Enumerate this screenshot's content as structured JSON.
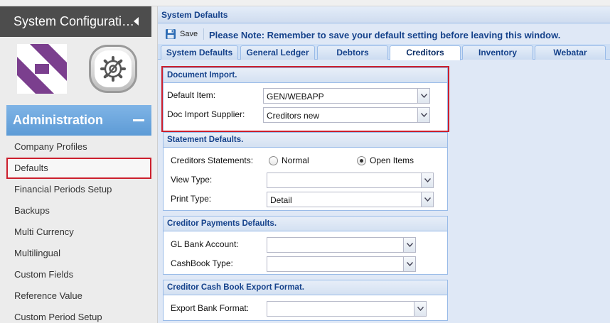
{
  "sidebar": {
    "title": "System Configurati…",
    "section_title": "Administration",
    "items": [
      {
        "label": "Company Profiles"
      },
      {
        "label": "Defaults",
        "selected": true
      },
      {
        "label": "Financial Periods Setup"
      },
      {
        "label": "Backups"
      },
      {
        "label": "Multi Currency"
      },
      {
        "label": "Multilingual"
      },
      {
        "label": "Custom Fields"
      },
      {
        "label": "Reference Value"
      },
      {
        "label": "Custom Period Setup"
      }
    ]
  },
  "panel": {
    "title": "System Defaults"
  },
  "toolbar": {
    "save_label": "Save",
    "note": "Please Note: Remember to save your default setting before leaving this window."
  },
  "tabs": [
    {
      "label": "System Defaults"
    },
    {
      "label": "General Ledger"
    },
    {
      "label": "Debtors"
    },
    {
      "label": "Creditors",
      "active": true
    },
    {
      "label": "Inventory"
    },
    {
      "label": "Webatar"
    }
  ],
  "document_import": {
    "header": "Document Import.",
    "default_item_label": "Default Item:",
    "default_item_value": "GEN/WEBAPP",
    "supplier_label": "Doc Import Supplier:",
    "supplier_value": "Creditors new"
  },
  "statement_defaults": {
    "header": "Statement Defaults.",
    "statements_label": "Creditors Statements:",
    "option_normal": "Normal",
    "option_open_items": "Open Items",
    "selected_option": "Open Items",
    "view_type_label": "View Type:",
    "view_type_value": "",
    "print_type_label": "Print Type:",
    "print_type_value": "Detail"
  },
  "payment_defaults": {
    "header": "Creditor Payments Defaults.",
    "gl_bank_label": "GL Bank Account:",
    "gl_bank_value": "",
    "cashbook_type_label": "CashBook Type:",
    "cashbook_type_value": ""
  },
  "export_format": {
    "header": "Creditor Cash Book Export Format.",
    "export_bank_label": "Export Bank Format:",
    "export_bank_value": ""
  },
  "colors": {
    "accent_blue": "#5d9bd6",
    "header_text": "#15428b",
    "highlight_red": "#cc1f2d",
    "sidebar_dark": "#4d4d4d",
    "logo_purple": "#7b3f8e"
  }
}
